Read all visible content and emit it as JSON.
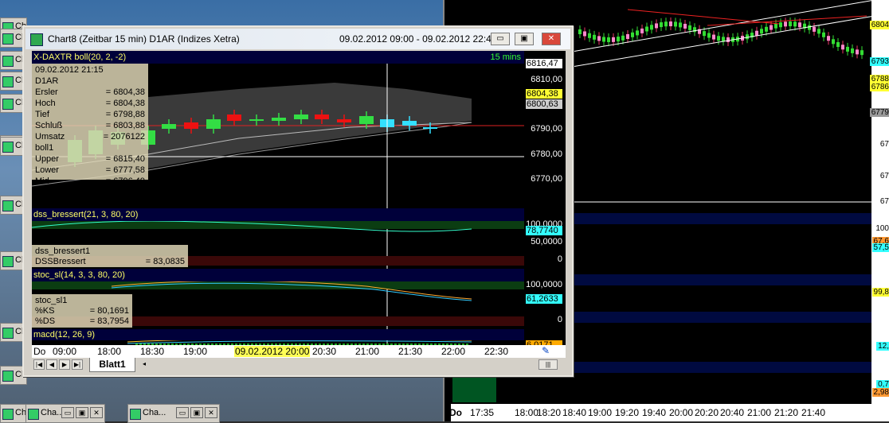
{
  "desktop": {
    "minimized": [
      {
        "label": "Ch"
      },
      {
        "label": "Ch"
      },
      {
        "label": "Ch"
      },
      {
        "label": "Ch"
      },
      {
        "label": "Ch"
      },
      {
        "label": "Cha..."
      },
      {
        "label": "Cha..."
      },
      {
        "label": "Cha..."
      },
      {
        "label": "Cha..."
      },
      {
        "label": "Cha..."
      },
      {
        "label": "Cha..."
      },
      {
        "label": "Cha..."
      },
      {
        "label": "Cha..."
      },
      {
        "label": "Cha..."
      }
    ]
  },
  "window": {
    "title": "Chart8 (Zeitbar 15 min)  D1AR (Indizes Xetra)",
    "daterange": "09.02.2012 09:00 - 09.02.2012 22:45",
    "btn_min": "▭",
    "btn_max": "▣",
    "btn_close": "✕"
  },
  "price_pane": {
    "title": "X-DAXTR boll(20, 2, -2)",
    "interval": "15 mins",
    "y_ticks": [
      "6810,00",
      "6800,00",
      "6790,00",
      "6780,00",
      "6770,00"
    ],
    "tags": {
      "upper": "6816,47",
      "last": "6804,38",
      "mid": "6800,63"
    },
    "info": {
      "date": "09.02.2012  21:15",
      "symbol": "D1AR",
      "rows": [
        {
          "k": "Ersler",
          "v": "= 6804,38"
        },
        {
          "k": "Hoch",
          "v": "= 6804,38"
        },
        {
          "k": "Tief",
          "v": "= 6798,88"
        },
        {
          "k": "Schluß",
          "v": "= 6803,88"
        },
        {
          "k": "Umsatz",
          "v": "= 2076122"
        },
        {
          "k": "boll1",
          "v": ""
        },
        {
          "k": "Upper",
          "v": "= 6815,40"
        },
        {
          "k": "Lower",
          "v": "= 6777,58"
        },
        {
          "k": "Mid",
          "v": "= 6796,49"
        }
      ]
    }
  },
  "dss_pane": {
    "title": "dss_bressert(21, 3, 80, 20)",
    "y_ticks": [
      "100,0000",
      "50,0000",
      "0"
    ],
    "tag": "78,7740",
    "info": [
      {
        "k": "dss_bressert1",
        "v": ""
      },
      {
        "k": "DSSBressert",
        "v": "= 83,0835"
      }
    ]
  },
  "stoc_pane": {
    "title": "stoc_sl(14, 3, 3, 80, 20)",
    "y_ticks": [
      "100,0000",
      "0"
    ],
    "tag": "61,2633",
    "info": [
      {
        "k": "stoc_sl1",
        "v": ""
      },
      {
        "k": "%KS",
        "v": "= 80,1691"
      },
      {
        "k": "%DS",
        "v": "= 83,7954"
      }
    ]
  },
  "macd_pane": {
    "title": "macd(12, 26, 9)",
    "tag": "6,0171",
    "info": [
      {
        "k": "macd1",
        "v": ""
      },
      {
        "k": "MACD",
        "v": "= 6,4846"
      }
    ]
  },
  "x_axis": {
    "labels": [
      "Do",
      "09:00",
      "18:00",
      "18:30",
      "19:00",
      "19:30",
      "20:30",
      "21:00",
      "21:30",
      "22:00",
      "22:30"
    ],
    "cursor_label": "09.02.2012 20:00"
  },
  "sheet": {
    "tab": "Blatt1"
  },
  "right_chart": {
    "tags": [
      "6804",
      "6793",
      "6788",
      "6786",
      "6779",
      "67",
      "67",
      "67",
      "100",
      "67,6",
      "57,5",
      "99,8",
      "12,",
      "0,7",
      "2,98"
    ],
    "x_labels": [
      "Do",
      "17:35",
      "18:00",
      "18:20",
      "18:40",
      "19:00",
      "19:20",
      "19:40",
      "20:00",
      "20:20",
      "20:40",
      "21:00",
      "21:20",
      "21:40"
    ]
  },
  "colors": {
    "bull": "#33dd44",
    "bear": "#ee1111",
    "band": "#444444",
    "ma": "#888888",
    "pane_bg": "#00003a"
  }
}
